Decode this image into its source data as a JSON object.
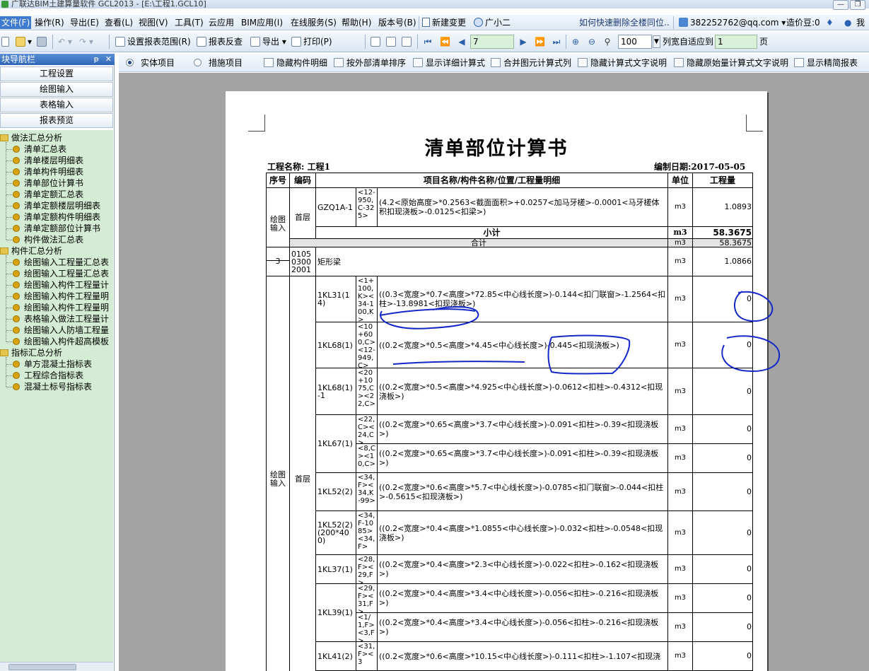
{
  "window": {
    "title": "广联达BIM土建算量软件 GCL2013 - [E:\\工程1.GCL10]"
  },
  "menu": [
    {
      "label": "文件(F)",
      "active": true
    },
    {
      "label": "操作(R)"
    },
    {
      "label": "导出(E)"
    },
    {
      "label": "查看(L)"
    },
    {
      "label": "视图(V)"
    },
    {
      "label": "工具(T)"
    },
    {
      "label": "云应用"
    },
    {
      "label": "BIM应用(I)"
    },
    {
      "label": "在线服务(S)"
    },
    {
      "label": "帮助(H)"
    },
    {
      "label": "版本号(B)"
    },
    {
      "label": "新建变更"
    },
    {
      "label": "广小二"
    }
  ],
  "menu_notice": "如何快速删除全楼同位..",
  "account": {
    "email": "382252762@qq.com ▾",
    "points": "造价豆:0",
    "user": "我"
  },
  "toolbar": {
    "set_range": "设置报表范围(R)",
    "report_check": "报表反查",
    "export": "导出 ▾",
    "print": "打印(P)",
    "page_current": "7",
    "zoom": "100",
    "fit_label": "列宽自适应到",
    "fit_value": "1",
    "page_unit": "页"
  },
  "options": {
    "radio_entity": "实体项目",
    "radio_measure": "措施项目",
    "hide_detail": "隐藏构件明细",
    "external_sort": "按外部清单排序",
    "show_formula": "显示详细计算式",
    "merge_formula": "合并图元计算式列",
    "hide_formula_text": "隐藏计算式文字说明",
    "hide_raw_text": "隐藏原始量计算式文字说明",
    "simple_report": "显示精简报表"
  },
  "sidebar": {
    "title": "块导航栏",
    "nav_buttons": [
      "工程设置",
      "绘图输入",
      "表格输入",
      "报表预览"
    ],
    "groups": [
      {
        "label": "做法汇总分析",
        "items": [
          "清单汇总表",
          "清单楼层明细表",
          "清单构件明细表",
          "清单部位计算书",
          "清单定额汇总表",
          "清单定额楼层明细表",
          "清单定额构件明细表",
          "清单定额部位计算书",
          "构件做法汇总表"
        ]
      },
      {
        "label": "构件汇总分析",
        "items": [
          "绘图输入工程量汇总表",
          "绘图输入工程量汇总表",
          "绘图输入构件工程量计",
          "绘图输入构件工程量明",
          "绘图输入构件工程量明",
          "表格输入做法工程量计",
          "绘图输入人防墙工程量",
          "绘图输入构件超高模板"
        ]
      },
      {
        "label": "指标汇总分析",
        "items": [
          "单方混凝土指标表",
          "工程综合指标表",
          "混凝土标号指标表"
        ]
      }
    ]
  },
  "report": {
    "title": "清单部位计算书",
    "project": "工程名称: 工程1",
    "date": "编制日期:2017-05-05",
    "headers": {
      "seq": "序号",
      "code": "编码",
      "desc": "项目名称/构件名称/位置/工程量明细",
      "unit": "单位",
      "qty": "工程量"
    },
    "top": {
      "group": "绘图输入",
      "floor": "首层",
      "component": "GZQ1A-1",
      "location": "<12-950,C-325>",
      "expr": "(4.2<原始高度>*0.2563<截面面积>+0.0257<加马牙槎>-0.0001<马牙槎体积扣现浇板>-0.0125<扣梁>)",
      "unit": "m3",
      "qty": "1.0893",
      "subtotal_label": "小计",
      "subtotal_unit": "m3",
      "subtotal_qty": "58.3675",
      "total_label": "合计",
      "total_unit": "m3",
      "total_qty": "58.3675"
    },
    "item": {
      "seq": "3",
      "code": "010503002001",
      "name": "矩形梁",
      "unit": "m3",
      "qty": "1.0866"
    },
    "group2": "绘图输入",
    "floor2": "首层",
    "rows": [
      {
        "comp": "1KL31(14)",
        "loc": "<1+100,K><34-100,K>",
        "expr": "((0.3<宽度>*0.7<高度>*72.85<中心线长度>)-0.144<扣门联窗>-1.2564<扣柱>-13.8981<扣现浇板>)",
        "unit": "m3",
        "qty": "0"
      },
      {
        "comp": "1KL68(1)",
        "loc": "<10+600,C><12-949,C>",
        "expr": "((0.2<宽度>*0.5<高度>*4.45<中心线长度>)-0.445<扣现浇板>)",
        "unit": "m3",
        "qty": "0"
      },
      {
        "comp": "1KL68(1)-1",
        "loc": "<20+1075,C><22,C>",
        "expr": "((0.2<宽度>*0.5<高度>*4.925<中心线长度>)-0.0612<扣柱>-0.4312<扣现浇板>)",
        "unit": "m3",
        "qty": "0"
      },
      {
        "comp": "1KL67(1)",
        "loc": "<22,C><24,C>",
        "expr": "((0.2<宽度>*0.65<高度>*3.7<中心线长度>)-0.091<扣柱>-0.39<扣现浇板>)",
        "unit": "m3",
        "qty": "0"
      },
      {
        "comp": "",
        "loc": "<8,C><10,C>",
        "expr": "((0.2<宽度>*0.65<高度>*3.7<中心线长度>)-0.091<扣柱>-0.39<扣现浇板>)",
        "unit": "m3",
        "qty": "0"
      },
      {
        "comp": "1KL52(2)",
        "loc": "<34,F><34,K-99>",
        "expr": "((0.2<宽度>*0.6<高度>*5.7<中心线长度>)-0.0785<扣门联窗>-0.044<扣柱>-0.5615<扣现浇板>)",
        "unit": "m3",
        "qty": "0"
      },
      {
        "comp": "1KL52(2)(200*400)",
        "loc": "<34,F-1085><34,F>",
        "expr": "((0.2<宽度>*0.4<高度>*1.0855<中心线长度>)-0.032<扣柱>-0.0548<扣现浇板>)",
        "unit": "m3",
        "qty": "0"
      },
      {
        "comp": "1KL37(1)",
        "loc": "<28,F><29,F>",
        "expr": "((0.2<宽度>*0.4<高度>*2.3<中心线长度>)-0.022<扣柱>-0.162<扣现浇板>)",
        "unit": "m3",
        "qty": "0"
      },
      {
        "comp": "1KL39(1)",
        "loc": "<29,F><31,F>",
        "expr": "((0.2<宽度>*0.4<高度>*3.4<中心线长度>)-0.056<扣柱>-0.216<扣现浇板>)",
        "unit": "m3",
        "qty": "0"
      },
      {
        "comp": "",
        "loc": "<1/1,F><3,F>",
        "expr": "((0.2<宽度>*0.4<高度>*3.4<中心线长度>)-0.056<扣柱>-0.216<扣现浇板>)",
        "unit": "m3",
        "qty": "0"
      },
      {
        "comp": "1KL41(2)",
        "loc": "<31,F><3",
        "expr": "((0.2<宽度>*0.6<高度>*10.15<中心线长度>)-0.111<扣柱>-1.107<扣现浇",
        "unit": "m3",
        "qty": "0"
      }
    ]
  },
  "colors": {
    "accent": "#3d7ad0",
    "tree_bg": "#d3ecd3",
    "viewer_bg": "#a3a3a3",
    "ink": "#1428c8"
  }
}
